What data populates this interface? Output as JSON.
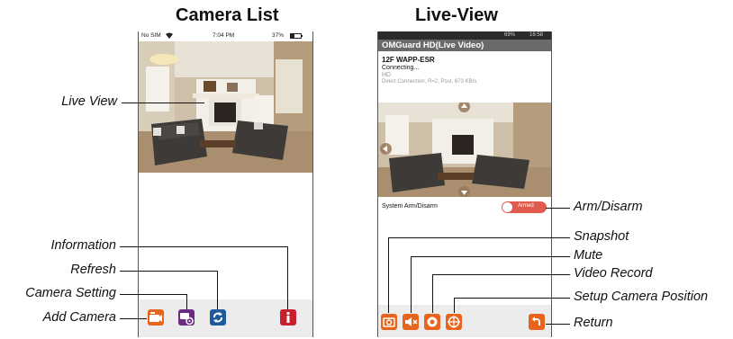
{
  "titles": {
    "left": "Camera List",
    "right": "Live-View"
  },
  "camera_list": {
    "status_left": "No SIM",
    "status_wifi": "wifi-icon",
    "status_time": "7:04 PM",
    "status_right": "37%",
    "toolbar_buttons": [
      {
        "name": "add-camera-button",
        "icon": "camera-plus-icon",
        "color": "#e8631c"
      },
      {
        "name": "camera-setting-button",
        "icon": "camera-gear-icon",
        "color": "#6a2c82"
      },
      {
        "name": "refresh-button",
        "icon": "refresh-icon",
        "color": "#1f5a9c"
      },
      {
        "name": "information-button",
        "icon": "info-icon",
        "color": "#c8202e"
      }
    ]
  },
  "live_view": {
    "status_right": "69%",
    "status_time": "16:58",
    "app_title": "OMGuard HD(Live Video)",
    "camera_name": "12F WAPP-ESR",
    "connection_status": "Connecting...",
    "quality": "HD",
    "connection_info": "Direct Connection, R=2, Post, 673 KB/s",
    "system_arm_label": "System Arm/Disarm",
    "arm_button_label": "Armed",
    "toolbar_buttons": [
      {
        "name": "snapshot-button",
        "icon": "snapshot-icon",
        "color": "#e8631c"
      },
      {
        "name": "mute-button",
        "icon": "mute-icon",
        "color": "#e8631c"
      },
      {
        "name": "video-record-button",
        "icon": "record-icon",
        "color": "#e8631c"
      },
      {
        "name": "setup-camera-position-button",
        "icon": "crosshair-icon",
        "color": "#e8631c"
      },
      {
        "name": "return-button",
        "icon": "return-icon",
        "color": "#e8631c"
      }
    ]
  },
  "callouts": {
    "live_view": "Live View",
    "information": "Information",
    "refresh": "Refresh",
    "camera_setting": "Camera Setting",
    "add_camera": "Add Camera",
    "arm_disarm": "Arm/Disarm",
    "snapshot": "Snapshot",
    "mute": "Mute",
    "video_record": "Video Record",
    "setup_camera_position": "Setup Camera Position",
    "return": "Return"
  }
}
